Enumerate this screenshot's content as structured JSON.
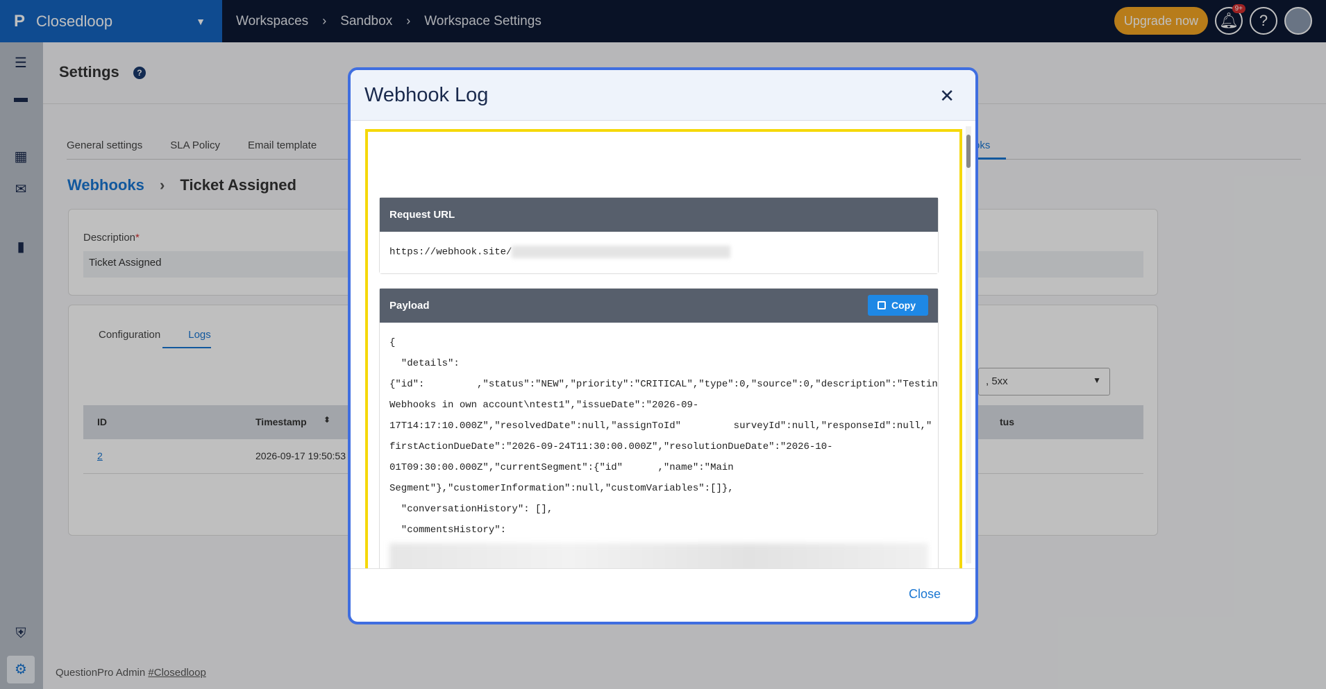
{
  "topbar": {
    "brand": "Closedloop",
    "breadcrumbs": [
      "Workspaces",
      "Sandbox",
      "Workspace Settings"
    ],
    "upgrade_label": "Upgrade now",
    "notif_badge": "9+",
    "help_glyph": "?"
  },
  "page": {
    "title": "Settings",
    "tabs": [
      "General settings",
      "SLA Policy",
      "Email template"
    ],
    "tab_right_partial": "oks",
    "breadcrumb_link": "Webhooks",
    "breadcrumb_current": "Ticket Assigned",
    "description_label": "Description",
    "description_required": "*",
    "description_value": "Ticket Assigned",
    "subtabs": [
      "Configuration",
      "Logs"
    ],
    "filter_partial": ", 5xx",
    "table": {
      "headers": [
        "ID",
        "Timestamp"
      ],
      "header_right_partial": "tus",
      "rows": [
        {
          "id": "2",
          "timestamp": "2026-09-17 19:50:53"
        }
      ]
    },
    "footer_text": "QuestionPro Admin",
    "footer_link": "#Closedloop"
  },
  "modal": {
    "title": "Webhook Log",
    "request_url_label": "Request URL",
    "request_url": "https://webhook.site/",
    "payload_label": "Payload",
    "copy_label": "Copy",
    "payload_lines": [
      "{",
      "  \"details\":",
      "{\"id\":         ,\"status\":\"NEW\",\"priority\":\"CRITICAL\",\"type\":0,\"source\":0,\"description\":\"Testing",
      "Webhooks in own account\\ntest1\",\"issueDate\":\"2026-09-",
      "17T14:17:10.000Z\",\"resolvedDate\":null,\"assignToId\"         surveyId\":null,\"responseId\":null,\"",
      "firstActionDueDate\":\"2026-09-24T11:30:00.000Z\",\"resolutionDueDate\":\"2026-10-",
      "01T09:30:00.000Z\",\"currentSegment\":{\"id\"      ,\"name\":\"Main",
      "Segment\"},\"customerInformation\":null,\"customVariables\":[]},",
      "  \"conversationHistory\": [],",
      "  \"commentsHistory\":"
    ],
    "close_label": "Close"
  }
}
